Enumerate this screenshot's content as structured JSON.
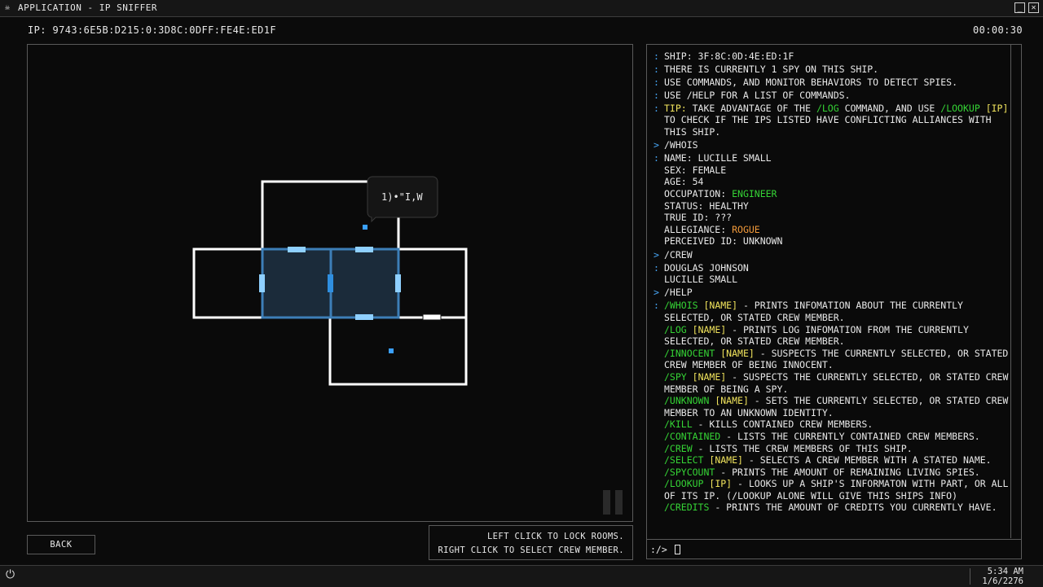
{
  "window": {
    "title": "APPLICATION - IP SNIFFER",
    "icon": "skull-icon",
    "minimize_label": "_",
    "close_label": "✕"
  },
  "header": {
    "ip": "IP: 9743:6E5B:D215:0:3D8C:0DFF:FE4E:ED1F",
    "timer": "00:00:30"
  },
  "map": {
    "speech_text": "1)•\"I,W",
    "highlight_color": "#1b2b3a",
    "door_color": "#8fd0ff",
    "crew_color": "#3aa0ff"
  },
  "buttons": {
    "back": "BACK"
  },
  "hints": {
    "line1": "LEFT CLICK TO LOCK ROOMS.",
    "line2": "RIGHT CLICK TO SELECT CREW MEMBER."
  },
  "console": {
    "lines": [
      {
        "p": ":",
        "segs": [
          {
            "t": "SHIP: 3F:8C:0D:4E:ED:1F"
          }
        ]
      },
      {
        "p": ":",
        "segs": [
          {
            "t": "THERE IS CURRENTLY 1 SPY ON THIS SHIP."
          }
        ]
      },
      {
        "p": ":",
        "segs": [
          {
            "t": "USE COMMANDS, AND MONITOR BEHAVIORS TO DETECT SPIES."
          }
        ]
      },
      {
        "p": ":",
        "segs": [
          {
            "t": "USE /HELP FOR A LIST OF COMMANDS."
          }
        ]
      },
      {
        "p": ":",
        "segs": [
          {
            "t": "TIP: ",
            "c": "yellow"
          },
          {
            "t": "TAKE ADVANTAGE OF THE "
          },
          {
            "t": "/LOG",
            "c": "green"
          },
          {
            "t": " COMMAND, AND USE "
          },
          {
            "t": "/LOOKUP",
            "c": "green"
          },
          {
            "t": " "
          },
          {
            "t": "[IP]",
            "c": "yellow"
          },
          {
            "t": " TO CHECK IF THE IPS LISTED HAVE CONFLICTING ALLIANCES WITH THIS SHIP."
          }
        ]
      },
      {
        "p": ">",
        "segs": [
          {
            "t": "/WHOIS"
          }
        ]
      },
      {
        "p": ":",
        "segs": [
          {
            "t": "NAME: LUCILLE SMALL"
          }
        ]
      },
      {
        "p": "",
        "segs": [
          {
            "t": "SEX: FEMALE"
          }
        ]
      },
      {
        "p": "",
        "segs": [
          {
            "t": "AGE: 54"
          }
        ]
      },
      {
        "p": "",
        "segs": [
          {
            "t": "OCCUPATION: "
          },
          {
            "t": "ENGINEER",
            "c": "green"
          }
        ]
      },
      {
        "p": "",
        "segs": [
          {
            "t": "STATUS: HEALTHY"
          }
        ]
      },
      {
        "p": "",
        "segs": [
          {
            "t": "TRUE ID: ???"
          }
        ]
      },
      {
        "p": "",
        "segs": [
          {
            "t": "ALLEGIANCE: "
          },
          {
            "t": "ROGUE",
            "c": "orange"
          }
        ]
      },
      {
        "p": "",
        "segs": [
          {
            "t": "PERCEIVED ID: UNKNOWN"
          }
        ]
      },
      {
        "p": ">",
        "segs": [
          {
            "t": "/CREW"
          }
        ]
      },
      {
        "p": ":",
        "segs": [
          {
            "t": "DOUGLAS JOHNSON"
          }
        ]
      },
      {
        "p": "",
        "segs": [
          {
            "t": "LUCILLE SMALL"
          }
        ]
      },
      {
        "p": ">",
        "segs": [
          {
            "t": "/HELP"
          }
        ]
      },
      {
        "p": ":",
        "segs": [
          {
            "t": "/WHOIS",
            "c": "green"
          },
          {
            "t": " "
          },
          {
            "t": "[NAME]",
            "c": "yellow"
          },
          {
            "t": " - PRINTS INFOMATION ABOUT THE CURRENTLY SELECTED, OR STATED CREW MEMBER."
          }
        ]
      },
      {
        "p": "",
        "segs": [
          {
            "t": "/LOG",
            "c": "green"
          },
          {
            "t": " "
          },
          {
            "t": "[NAME]",
            "c": "yellow"
          },
          {
            "t": " - PRINTS LOG INFOMATION FROM THE CURRENTLY SELECTED, OR STATED CREW MEMBER."
          }
        ]
      },
      {
        "p": "",
        "segs": [
          {
            "t": "/INNOCENT",
            "c": "green"
          },
          {
            "t": " "
          },
          {
            "t": "[NAME]",
            "c": "yellow"
          },
          {
            "t": " - SUSPECTS THE CURRENTLY SELECTED, OR STATED CREW MEMBER OF BEING INNOCENT."
          }
        ]
      },
      {
        "p": "",
        "segs": [
          {
            "t": "/SPY",
            "c": "green"
          },
          {
            "t": " "
          },
          {
            "t": "[NAME]",
            "c": "yellow"
          },
          {
            "t": " - SUSPECTS THE CURRENTLY SELECTED, OR STATED CREW MEMBER OF BEING A SPY."
          }
        ]
      },
      {
        "p": "",
        "segs": [
          {
            "t": "/UNKNOWN",
            "c": "green"
          },
          {
            "t": " "
          },
          {
            "t": "[NAME]",
            "c": "yellow"
          },
          {
            "t": " - SETS THE CURRENTLY SELECTED, OR STATED CREW MEMBER TO AN UNKNOWN IDENTITY."
          }
        ]
      },
      {
        "p": "",
        "segs": [
          {
            "t": "/KILL",
            "c": "green"
          },
          {
            "t": " - KILLS CONTAINED CREW MEMBERS."
          }
        ]
      },
      {
        "p": "",
        "segs": [
          {
            "t": "/CONTAINED",
            "c": "green"
          },
          {
            "t": " - LISTS THE CURRENTLY CONTAINED CREW MEMBERS."
          }
        ]
      },
      {
        "p": "",
        "segs": [
          {
            "t": "/CREW",
            "c": "green"
          },
          {
            "t": " - LISTS THE CREW MEMBERS OF THIS SHIP."
          }
        ]
      },
      {
        "p": "",
        "segs": [
          {
            "t": "/SELECT",
            "c": "green"
          },
          {
            "t": " "
          },
          {
            "t": "[NAME]",
            "c": "yellow"
          },
          {
            "t": " - SELECTS A CREW MEMBER WITH A STATED NAME."
          }
        ]
      },
      {
        "p": "",
        "segs": [
          {
            "t": "/SPYCOUNT",
            "c": "green"
          },
          {
            "t": " - PRINTS THE AMOUNT OF REMAINING LIVING SPIES."
          }
        ]
      },
      {
        "p": "",
        "segs": [
          {
            "t": "/LOOKUP",
            "c": "green"
          },
          {
            "t": " "
          },
          {
            "t": "[IP]",
            "c": "yellow"
          },
          {
            "t": " - LOOKS UP A SHIP'S INFORMATON WITH PART, OR ALL OF ITS IP. (/LOOKUP ALONE WILL GIVE THIS SHIPS INFO)"
          }
        ]
      },
      {
        "p": "",
        "segs": [
          {
            "t": "/CREDITS",
            "c": "green"
          },
          {
            "t": " - PRINTS THE AMOUNT OF CREDITS YOU CURRENTLY HAVE."
          }
        ]
      }
    ],
    "prompt": ":/>",
    "input_value": ""
  },
  "taskbar": {
    "power_icon": "power-icon",
    "time": "5:34 AM",
    "date": "1/6/2276"
  }
}
